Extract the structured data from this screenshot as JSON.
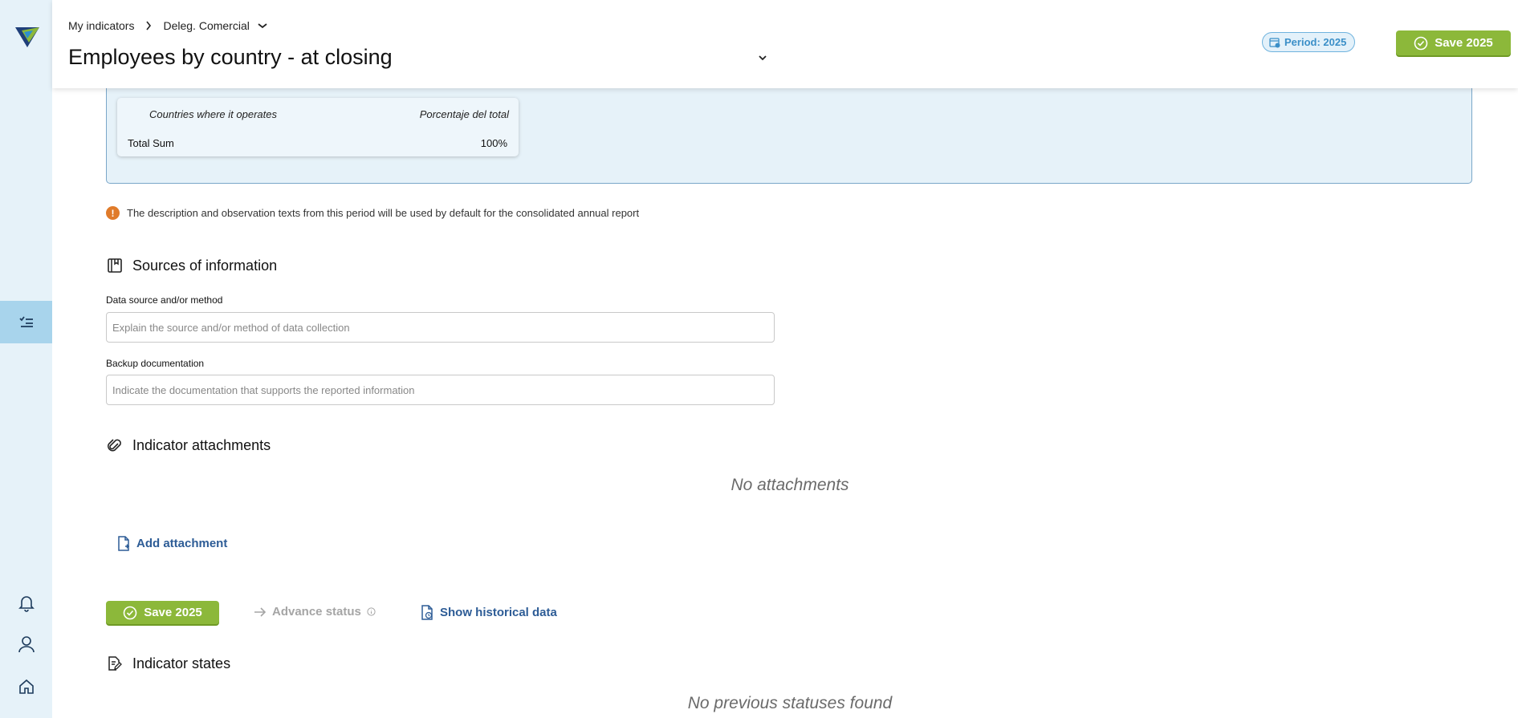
{
  "breadcrumb": {
    "root": "My indicators",
    "current": "Deleg. Comercial"
  },
  "header": {
    "title": "Employees by country - at closing",
    "period": "Period: 2025",
    "save_label": "Save 2025"
  },
  "summary_table": {
    "col1": "Countries where it operates",
    "col2": "Porcentaje del total",
    "row_label": "Total Sum",
    "row_value": "100%"
  },
  "notice": "The description and observation texts from this period will be used by default for the consolidated annual report",
  "sources": {
    "title": "Sources of information",
    "data_source_label": "Data source and/or method",
    "data_source_placeholder": "Explain the source and/or method of data collection",
    "backup_label": "Backup documentation",
    "backup_placeholder": "Indicate the documentation that supports the reported information"
  },
  "attachments": {
    "title": "Indicator attachments",
    "empty": "No attachments",
    "add_label": "Add attachment"
  },
  "actions": {
    "save_label": "Save 2025",
    "advance_label": "Advance status",
    "historical_label": "Show historical data"
  },
  "states": {
    "title": "Indicator states",
    "empty": "No previous statuses found"
  },
  "colors": {
    "accent_green": "#8cb83a",
    "link_blue": "#2d5c96",
    "rail_bg": "#e6f2f9",
    "warning": "#e07b2a"
  },
  "icons": [
    "logo",
    "checklist-icon",
    "bell-icon",
    "user-icon",
    "home-icon",
    "chevron-right-icon",
    "chevron-down-icon",
    "calendar-icon",
    "check-circle-icon",
    "alert-icon",
    "book-icon",
    "paperclip-icon",
    "file-plus-icon",
    "arrow-right-icon",
    "info-icon",
    "file-clock-icon",
    "file-edit-icon"
  ]
}
